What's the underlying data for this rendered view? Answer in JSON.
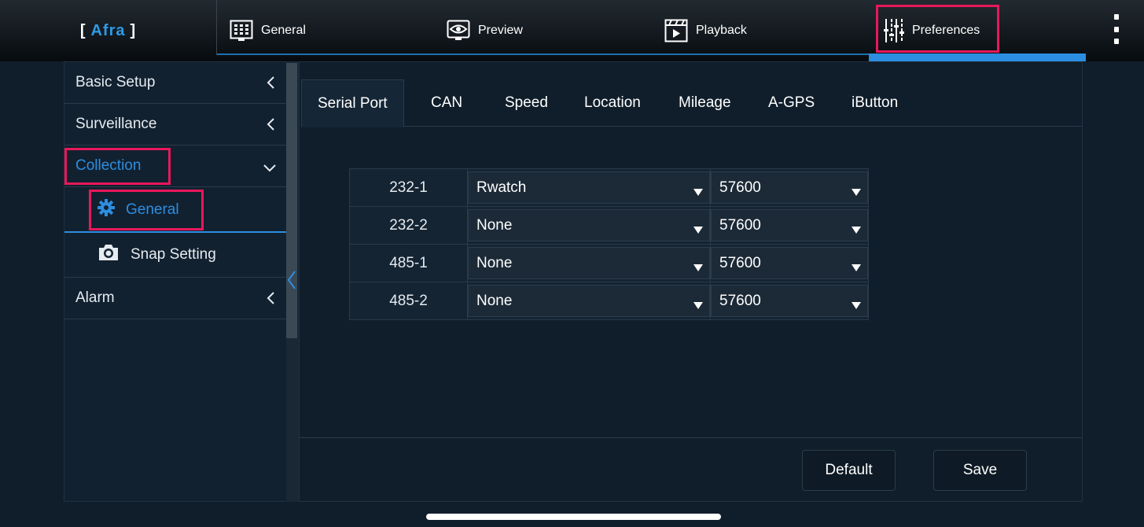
{
  "header": {
    "brand_open": "[",
    "brand_name": "Afra",
    "brand_close": "]",
    "tabs": [
      {
        "label": "General",
        "icon": "grid-monitor-icon"
      },
      {
        "label": "Preview",
        "icon": "eye-monitor-icon"
      },
      {
        "label": "Playback",
        "icon": "film-clapper-icon"
      },
      {
        "label": "Preferences",
        "icon": "sliders-icon",
        "active": true
      }
    ],
    "menu_icon": "kebab-menu-icon"
  },
  "sidebar": {
    "items": [
      {
        "label": "Basic Setup",
        "expanded": false
      },
      {
        "label": "Surveillance",
        "expanded": false
      },
      {
        "label": "Collection",
        "expanded": true,
        "active": true
      },
      {
        "label": "Alarm",
        "expanded": false
      }
    ],
    "collection_children": [
      {
        "label": "General",
        "icon": "gear-icon",
        "active": true
      },
      {
        "label": "Snap Setting",
        "icon": "camera-icon"
      }
    ]
  },
  "content": {
    "subtabs": [
      "Serial Port",
      "CAN",
      "Speed",
      "Location",
      "Mileage",
      "A-GPS",
      "iButton"
    ],
    "active_subtab": "Serial Port",
    "ports": [
      {
        "name": "232-1",
        "protocol": "Rwatch",
        "baud": "57600"
      },
      {
        "name": "232-2",
        "protocol": "None",
        "baud": "57600"
      },
      {
        "name": "485-1",
        "protocol": "None",
        "baud": "57600"
      },
      {
        "name": "485-2",
        "protocol": "None",
        "baud": "57600"
      }
    ],
    "buttons": {
      "default": "Default",
      "save": "Save"
    }
  },
  "colors": {
    "accent": "#2c8ee0",
    "highlight": "#e8185b",
    "background": "#101e2b"
  }
}
